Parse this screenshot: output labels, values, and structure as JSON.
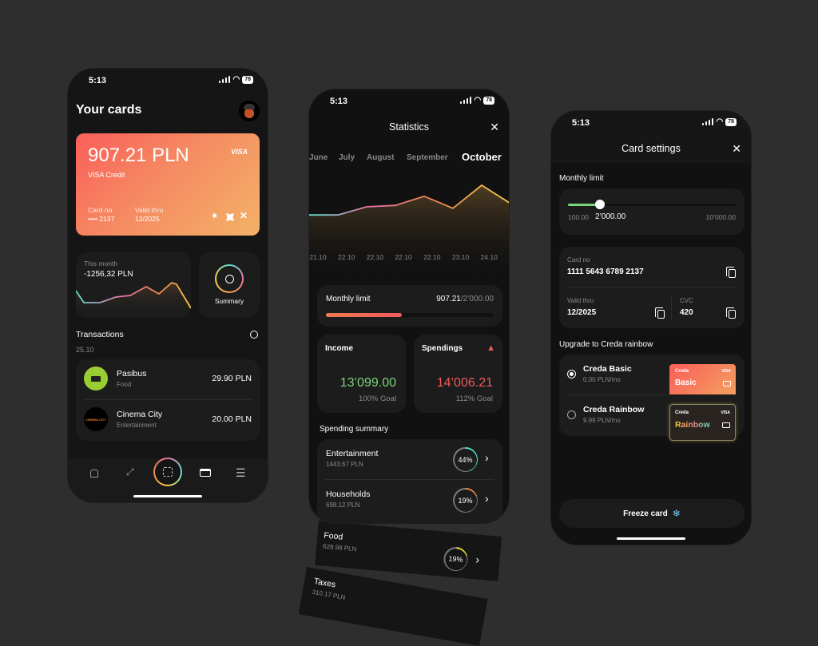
{
  "status": {
    "time": "5:13",
    "battery": "78"
  },
  "cards_screen": {
    "title": "Your cards",
    "card": {
      "balance": "907.21 PLN",
      "brand": "VISA",
      "type": "VISA Credit",
      "card_no_label": "Card no",
      "card_no": "•••• 2137",
      "valid_label": "Valid thru",
      "valid": "12/2025"
    },
    "this_month": {
      "label": "This month",
      "value": "-1256,32 PLN"
    },
    "summary_label": "Summary",
    "transactions": {
      "title": "Transactions",
      "date": "25.10",
      "items": [
        {
          "name": "Pasibus",
          "category": "Food",
          "amount": "29.90 PLN",
          "logo_color": "#9acd32"
        },
        {
          "name": "Cinema City",
          "category": "Entertainment",
          "amount": "20.00 PLN",
          "logo_text": "CINEMA CITY"
        }
      ]
    },
    "nav": [
      "home-icon",
      "expand-icon",
      "scan-icon",
      "card-icon",
      "menu-icon"
    ]
  },
  "statistics_screen": {
    "title": "Statistics",
    "months": [
      "June",
      "July",
      "August",
      "September",
      "October"
    ],
    "selected_month": "October",
    "chart_data": {
      "type": "area",
      "x": [
        "21.10",
        "22.10",
        "22.10",
        "22.10",
        "22.10",
        "23.10",
        "24.10"
      ],
      "values": [
        38,
        38,
        55,
        58,
        77,
        52,
        100,
        62
      ],
      "title": "",
      "xlabel": "",
      "ylabel": ""
    },
    "monthly_limit": {
      "label": "Monthly limit",
      "spent": "907.21",
      "total": "/2’000.00",
      "progress": 0.4536
    },
    "income": {
      "label": "Income",
      "value": "13’099.00",
      "goal": "100% Goal"
    },
    "spendings": {
      "label": "Spendings",
      "value": "14’006.21",
      "goal": "112% Goal"
    },
    "summary_title": "Spending summary",
    "summary": [
      {
        "name": "Entertainment",
        "amount": "1443.67 PLN",
        "percent": "44%",
        "fraction": 0.44,
        "color": "#5ce0d0"
      },
      {
        "name": "Households",
        "amount": "698.12 PLN",
        "percent": "19%",
        "fraction": 0.19,
        "color": "#f08a4b"
      },
      {
        "name": "Food",
        "amount": "628.98 PLN",
        "percent": "19%",
        "fraction": 0.19,
        "color": "#f0e030"
      },
      {
        "name": "Taxes",
        "amount": "310.17 PLN"
      }
    ]
  },
  "settings_screen": {
    "title": "Card settings",
    "monthly_limit": {
      "label": "Monthly limit",
      "min": "100.00",
      "value": "2’000.00",
      "max": "10’000.00",
      "fraction": 0.19
    },
    "card_no_label": "Card no",
    "card_no": "1111 5643 6789 2137",
    "valid_label": "Valid thru",
    "valid": "12/2025",
    "cvc_label": "CVC",
    "cvc": "420",
    "upgrade_title": "Upgrade to Creda rainbow",
    "plans": [
      {
        "name": "Creda Basic",
        "price": "0.00 PLN/mo",
        "selected": true,
        "card_brand": "Creda",
        "card_name": "Basic",
        "visa": "VISA"
      },
      {
        "name": "Creda Rainbow",
        "price": "9.99 PLN/mo",
        "selected": false,
        "card_brand": "Creda",
        "card_name": "Rainbow",
        "visa": "VISA"
      }
    ],
    "freeze_label": "Freeze card"
  }
}
